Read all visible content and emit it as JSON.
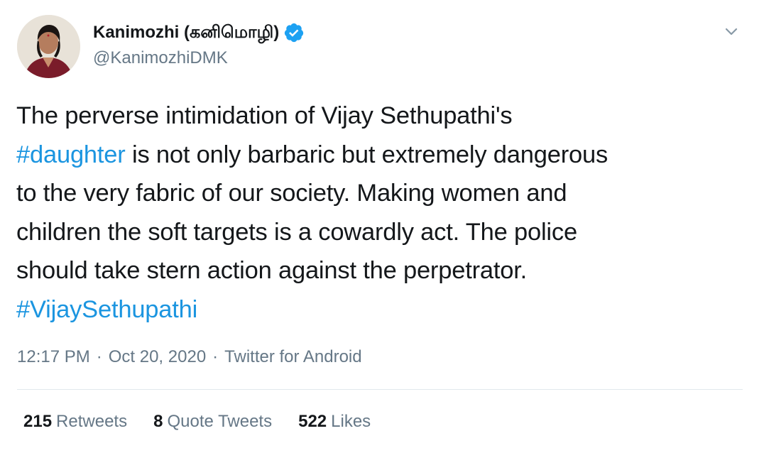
{
  "author": {
    "display_name": "Kanimozhi (கனிமொழி)",
    "handle": "@KanimozhiDMK",
    "verified": true,
    "avatar_icon": "profile-photo"
  },
  "tweet": {
    "lines": [
      [
        {
          "text": "The perverse intimidation of Vijay Sethupathi's",
          "hashtag": false
        }
      ],
      [
        {
          "text": "#daughter",
          "hashtag": true
        },
        {
          "text": " is not only barbaric but extremely dangerous",
          "hashtag": false
        }
      ],
      [
        {
          "text": "to the very fabric of our society. Making women and",
          "hashtag": false
        }
      ],
      [
        {
          "text": "children the soft targets is a cowardly act. The police",
          "hashtag": false
        }
      ],
      [
        {
          "text": "should take stern action against the perpetrator.",
          "hashtag": false
        }
      ],
      [
        {
          "text": "#VijaySethupathi",
          "hashtag": true
        }
      ]
    ],
    "time": "12:17 PM",
    "date": "Oct 20, 2020",
    "source": "Twitter for Android",
    "separator": "·"
  },
  "stats": {
    "retweets_count": "215",
    "retweets_label": "Retweets",
    "quotes_count": "8",
    "quotes_label": "Quote Tweets",
    "likes_count": "522",
    "likes_label": "Likes"
  },
  "colors": {
    "hashtag": "#1b95e0",
    "verified_badge": "#1da1f2",
    "secondary_text": "#657786",
    "primary_text": "#14171a",
    "divider": "#e1e8ed"
  }
}
